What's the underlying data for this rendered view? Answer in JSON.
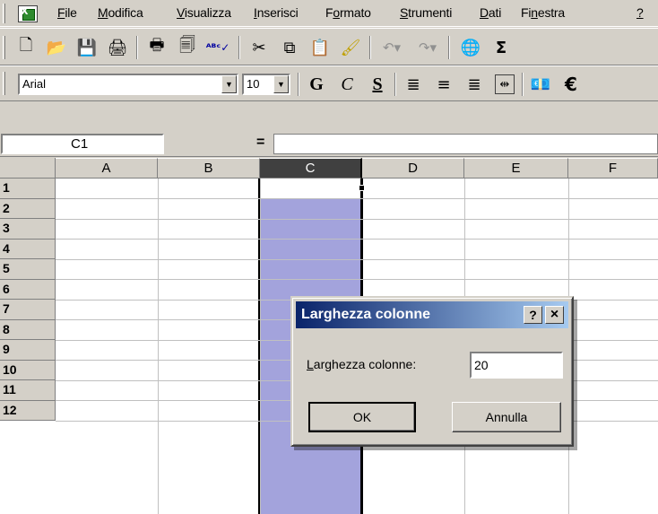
{
  "menu": {
    "items": [
      {
        "label": "File",
        "key": "F"
      },
      {
        "label": "Modifica",
        "key": "M"
      },
      {
        "label": "Visualizza",
        "key": "V"
      },
      {
        "label": "Inserisci",
        "key": "I"
      },
      {
        "label": "Formato",
        "key": "o"
      },
      {
        "label": "Strumenti",
        "key": "S"
      },
      {
        "label": "Dati",
        "key": "D"
      },
      {
        "label": "Finestra",
        "key": "n"
      },
      {
        "label": "?",
        "key": "?"
      }
    ]
  },
  "standard_toolbar": {
    "buttons": [
      "new-icon",
      "open-icon",
      "save-icon",
      "permission-icon",
      "print-icon",
      "print-preview-icon",
      "spelling-icon",
      "cut-icon",
      "copy-icon",
      "paste-icon",
      "format-painter-icon",
      "undo-icon",
      "redo-icon",
      "hyperlink-icon",
      "autosum-icon"
    ]
  },
  "format_toolbar": {
    "font": "Arial",
    "size": "10",
    "bold": "G",
    "italic": "C",
    "underline": "S",
    "buttons": [
      "align-left-icon",
      "align-center-icon",
      "align-right-icon",
      "merge-center-icon",
      "currency-icon",
      "euro-icon"
    ]
  },
  "formula_bar": {
    "name_box": "C1",
    "equals": "="
  },
  "sheet": {
    "columns": [
      "A",
      "B",
      "C",
      "D",
      "E",
      "F"
    ],
    "rows": [
      "1",
      "2",
      "3",
      "4",
      "5",
      "6",
      "7",
      "8",
      "9",
      "10",
      "11",
      "12"
    ],
    "selected_column": "C",
    "selection_color": "#a3a3dc"
  },
  "dialog": {
    "title": "Larghezza colonne",
    "help_label": "?",
    "close_label": "×",
    "field_label": "Larghezza colonne:",
    "field_key": "L",
    "field_value": "20",
    "ok_label": "OK",
    "cancel_label": "Annulla"
  }
}
